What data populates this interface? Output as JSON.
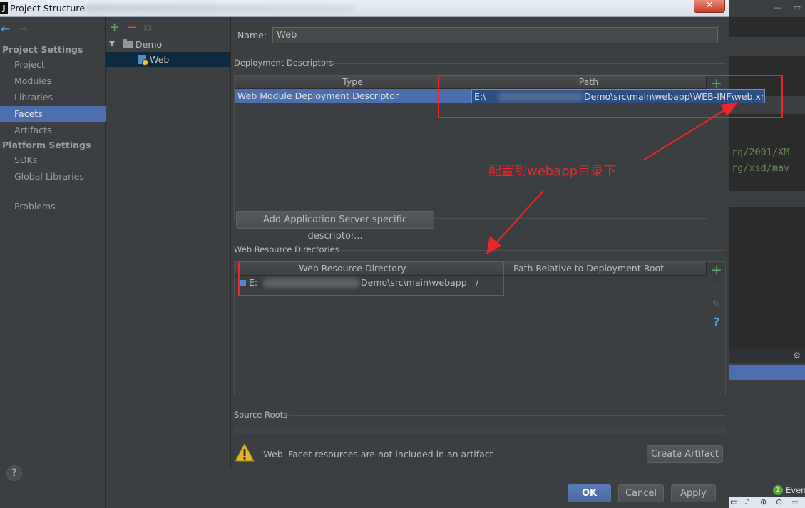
{
  "window": {
    "app_icon": "J",
    "title": "Project Structure",
    "close_label": "✕"
  },
  "nav": {
    "back_icon": "←",
    "forward_icon": "→"
  },
  "sidebar": {
    "sections": [
      {
        "title": "Project Settings",
        "items": [
          "Project",
          "Modules",
          "Libraries",
          "Facets",
          "Artifacts"
        ]
      },
      {
        "title": "Platform Settings",
        "items": [
          "SDKs",
          "Global Libraries"
        ]
      }
    ],
    "problems": "Problems",
    "active_item": "Facets",
    "help_label": "?"
  },
  "tree": {
    "toolbar": {
      "add": "+",
      "remove": "−",
      "copy": "⧉"
    },
    "root": "Demo",
    "child": "Web"
  },
  "facet": {
    "name_label": "Name:",
    "name_value": "Web",
    "deployment_descriptors": {
      "title": "Deployment Descriptors",
      "columns": [
        "Type",
        "Path"
      ],
      "row": {
        "type": "Web Module Deployment Descriptor",
        "path_prefix": "E:\\",
        "path_suffix": "Demo\\src\\main\\webapp\\WEB-INF\\web.xml"
      },
      "add_icon": "+"
    },
    "add_server_descriptor_button": "Add Application Server specific descriptor...",
    "web_resource_directories": {
      "title": "Web Resource Directories",
      "columns": [
        "Web Resource Directory",
        "Path Relative to Deployment Root"
      ],
      "row": {
        "dir_prefix": "E:",
        "dir_suffix": "Demo\\src\\main\\webapp",
        "relative_path": "/"
      },
      "tools": {
        "add": "+",
        "remove": "−",
        "edit": "✎",
        "help": "?"
      }
    },
    "source_roots": {
      "title": "Source Roots"
    },
    "warning": {
      "text": "'Web' Facet resources are not included in an artifact",
      "create_artifact_button": "Create Artifact"
    }
  },
  "dialog_buttons": {
    "ok": "OK",
    "cancel": "Cancel",
    "apply": "Apply"
  },
  "annotation": {
    "text": "配置到webapp目录下",
    "color": "#e8262b"
  },
  "background_editor": {
    "code_lines": [
      "rg/2001/XM",
      "rg/xsd/mav"
    ],
    "events_count": "1",
    "events_label": "Event",
    "gear_icon": "⚙",
    "taskbar_items": [
      "中",
      "♪",
      "⊕",
      "⊕",
      "☰"
    ]
  }
}
